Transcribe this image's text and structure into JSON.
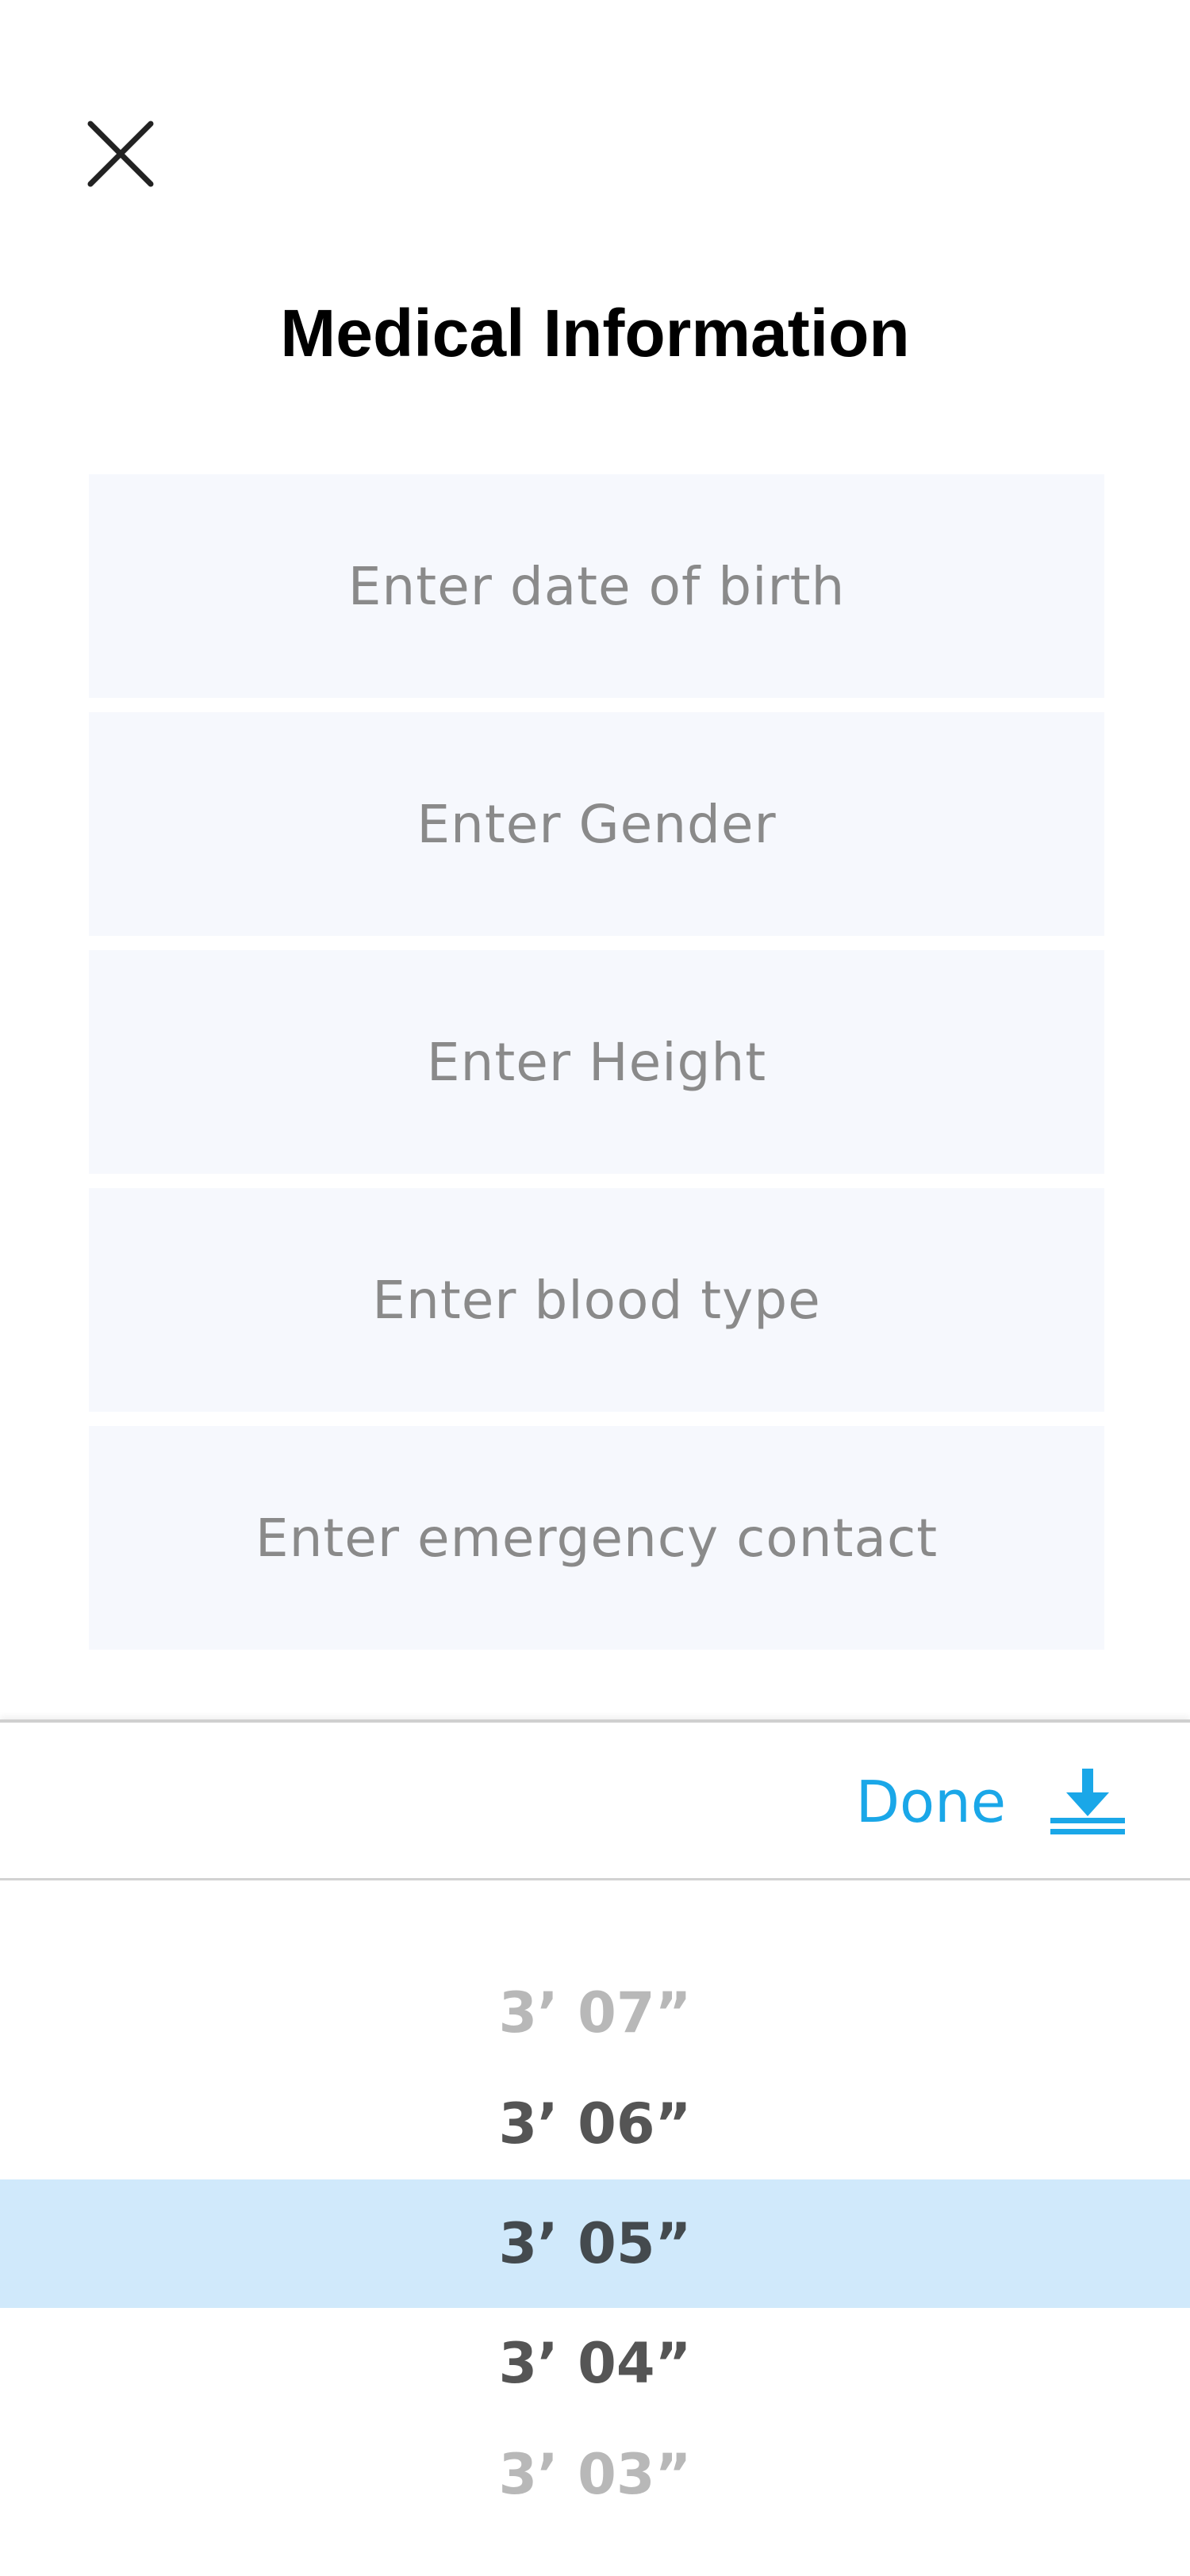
{
  "header": {
    "title": "Medical Information",
    "close_icon": "close-icon"
  },
  "form": {
    "fields": [
      {
        "placeholder": "Enter date of birth"
      },
      {
        "placeholder": "Enter Gender"
      },
      {
        "placeholder": "Enter Height"
      },
      {
        "placeholder": "Enter blood type"
      },
      {
        "placeholder": "Enter emergency contact"
      }
    ]
  },
  "picker": {
    "done_label": "Done",
    "done_icon": "download-icon",
    "accent_color": "#1aa7e8",
    "selected_color": "#d0e9fb",
    "options": [
      "3’ 07”",
      "3’ 06”",
      "3’ 05”",
      "3’ 04”",
      "3’ 03”"
    ],
    "selected": "3’ 05”"
  }
}
